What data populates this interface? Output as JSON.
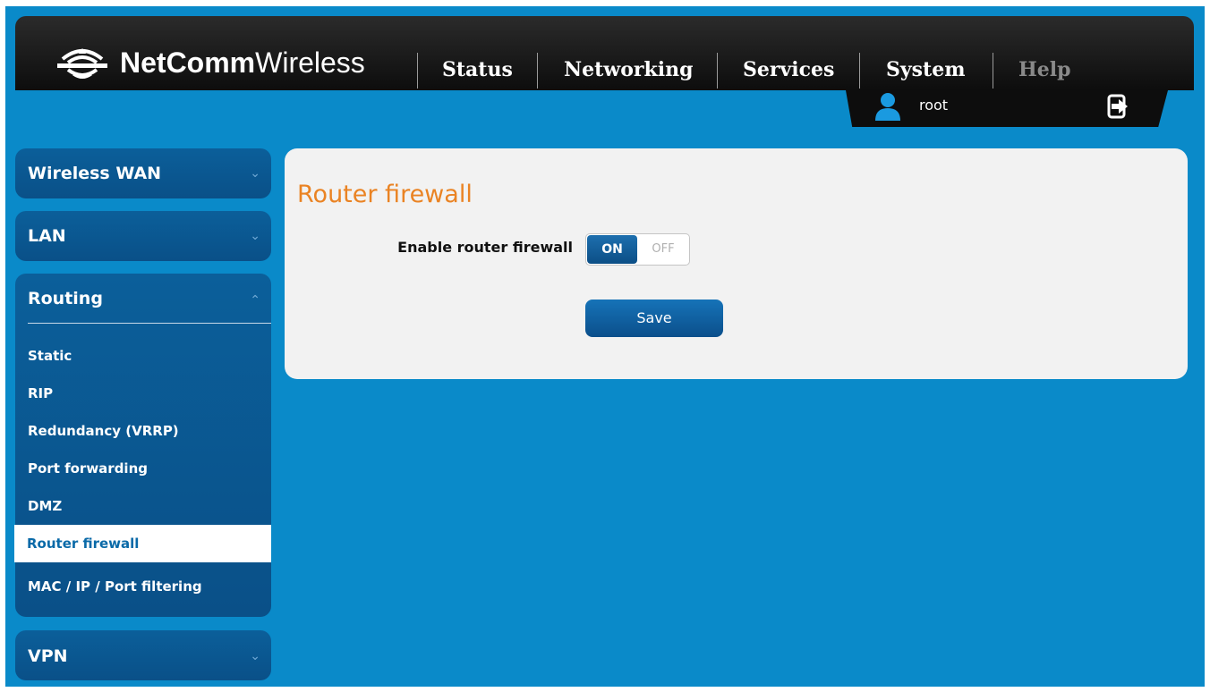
{
  "brand": {
    "part1": "NetComm",
    "part2": "Wireless"
  },
  "nav": {
    "items": [
      {
        "label": "Status"
      },
      {
        "label": "Networking"
      },
      {
        "label": "Services"
      },
      {
        "label": "System"
      },
      {
        "label": "Help"
      }
    ]
  },
  "user": {
    "name": "root"
  },
  "sidebar": {
    "wireless_wan": "Wireless WAN",
    "lan": "LAN",
    "routing": "Routing",
    "vpn": "VPN",
    "routing_items": [
      "Static",
      "RIP",
      "Redundancy (VRRP)",
      "Port forwarding",
      "DMZ",
      "Router firewall",
      "MAC / IP / Port filtering"
    ],
    "active_item": "Router firewall"
  },
  "main": {
    "title": "Router firewall",
    "field_label": "Enable router firewall",
    "toggle_on": "ON",
    "toggle_off": "OFF",
    "toggle_state": "ON",
    "save_label": "Save"
  },
  "colors": {
    "background": "#0a8ac9",
    "sidebar": "#0b5f9a",
    "title": "#ea8323",
    "active_text": "#0a6aa8"
  }
}
